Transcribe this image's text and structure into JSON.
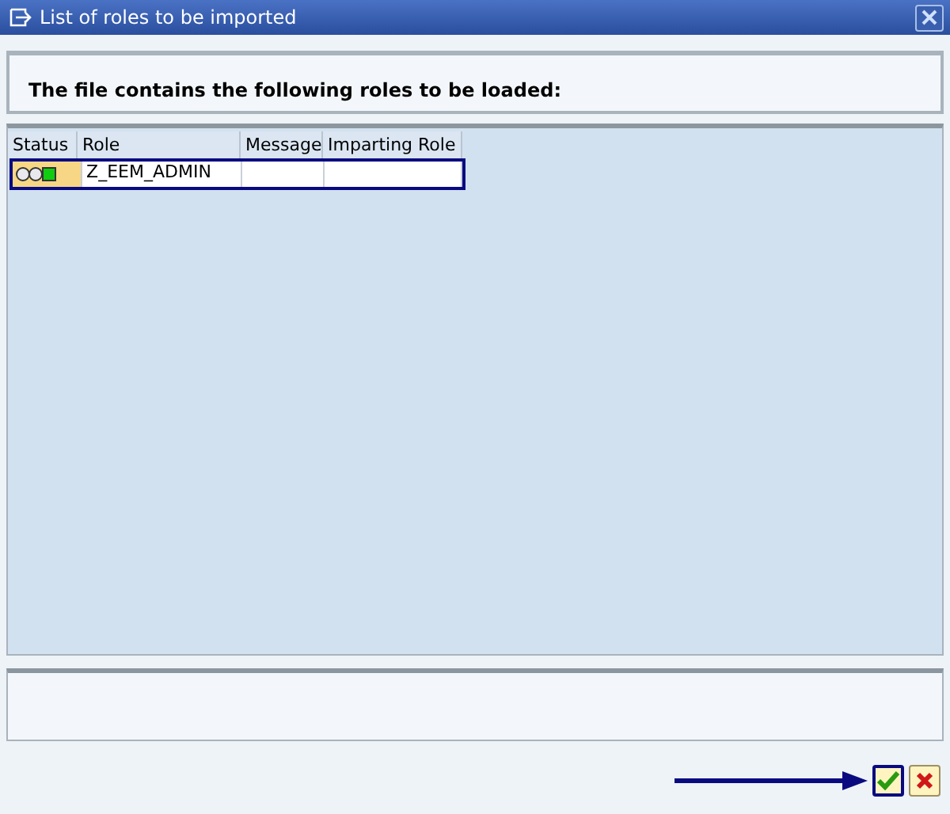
{
  "window": {
    "title": "List of roles to be imported"
  },
  "header": {
    "text": "The file contains the following roles to be loaded:"
  },
  "table": {
    "columns": [
      "Status",
      "Role",
      "Message",
      "Imparting Role"
    ],
    "rows": [
      {
        "color": "#11cc11",
        "role": "Z_EEM_ADMIN",
        "selected": true
      }
    ]
  },
  "buttons": [
    {
      "kind": "confirm",
      "highlighted": true
    },
    {
      "kind": "cancel",
      "highlighted": false
    }
  ]
}
